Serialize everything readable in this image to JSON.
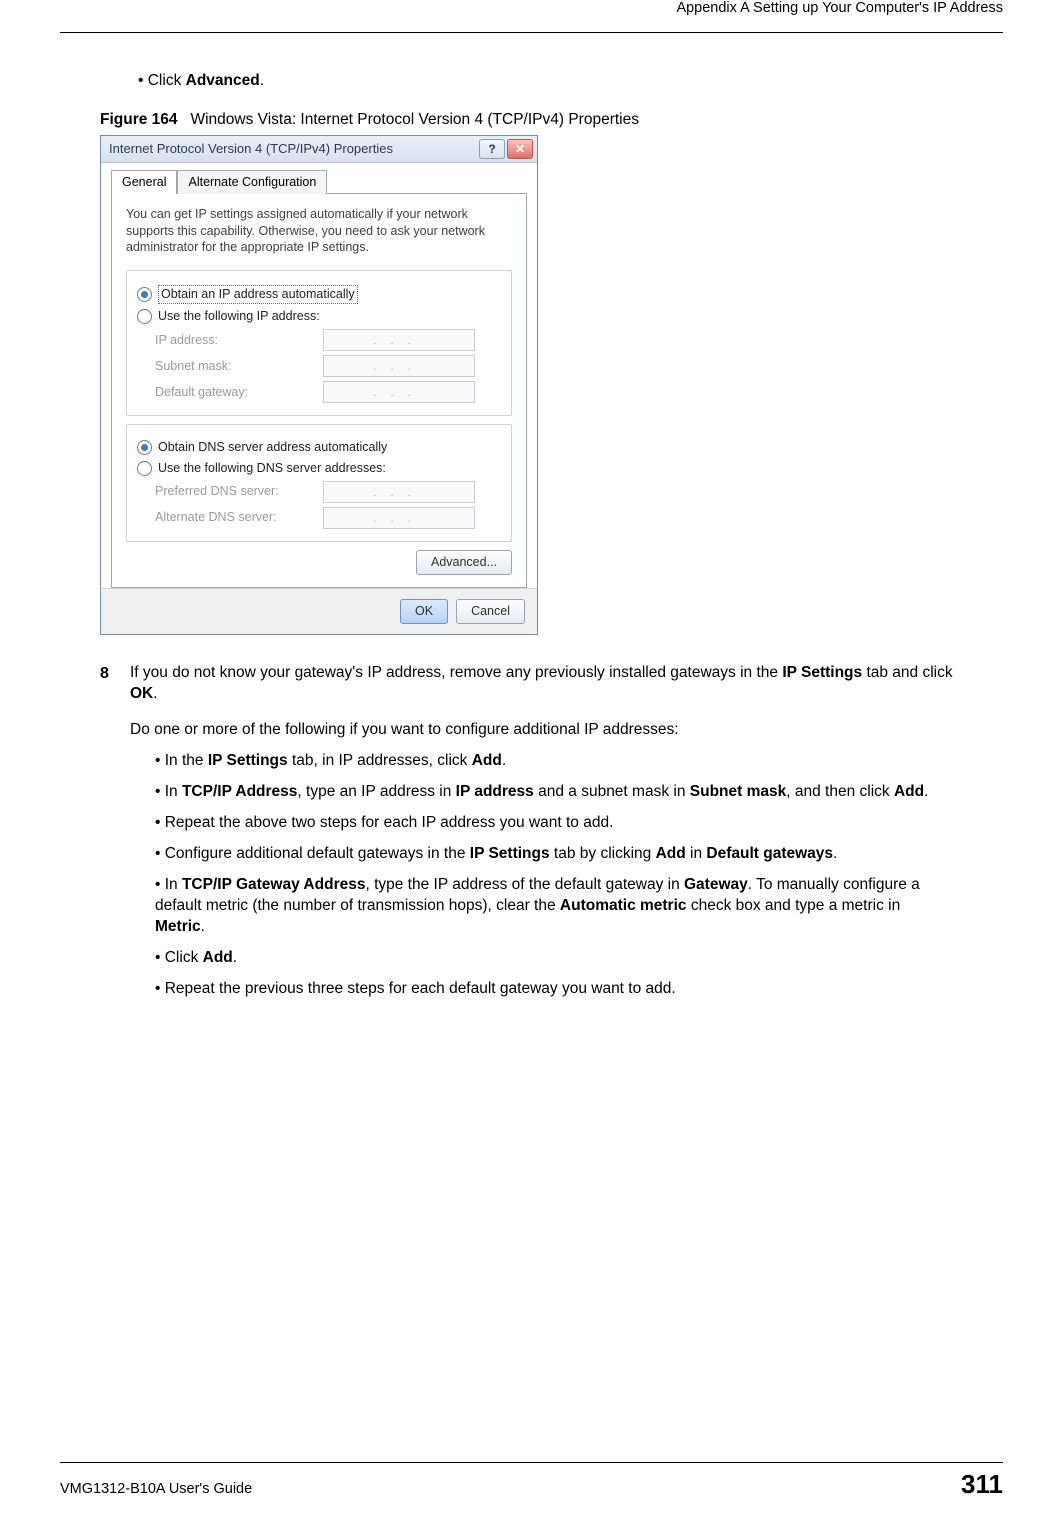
{
  "header": {
    "appendix": "Appendix A Setting up Your Computer's IP Address"
  },
  "intro_bullet": {
    "prefix": "Click ",
    "bold": "Advanced",
    "suffix": "."
  },
  "figure": {
    "label": "Figure 164",
    "caption": "Windows Vista: Internet Protocol Version 4 (TCP/IPv4) Properties"
  },
  "dialog": {
    "title": "Internet Protocol Version 4 (TCP/IPv4) Properties",
    "help_glyph": "?",
    "close_glyph": "✕",
    "tabs": {
      "general": "General",
      "alt": "Alternate Configuration"
    },
    "desc": "You can get IP settings assigned automatically if your network supports this capability. Otherwise, you need to ask your network administrator for the appropriate IP settings.",
    "ip_group": {
      "auto": "Obtain an IP address automatically",
      "manual": "Use the following IP address:",
      "ip_label": "IP address:",
      "subnet_label": "Subnet mask:",
      "gateway_label": "Default gateway:"
    },
    "dns_group": {
      "auto": "Obtain DNS server address automatically",
      "manual": "Use the following DNS server addresses:",
      "pref_label": "Preferred DNS server:",
      "alt_label": "Alternate DNS server:"
    },
    "ip_placeholder": "...",
    "advanced_btn": "Advanced...",
    "ok_btn": "OK",
    "cancel_btn": "Cancel"
  },
  "step8": {
    "num": "8",
    "t1": "If you do not know your gateway's IP address, remove any previously installed gateways in the ",
    "b1": "IP Settings",
    "t2": " tab and click ",
    "b2": "OK",
    "t3": "."
  },
  "para_do": "Do one or more of the following if you want to configure additional IP addresses:",
  "bul1": {
    "t1": "In the ",
    "b1": "IP Settings",
    "t2": " tab, in IP addresses, click ",
    "b2": "Add",
    "t3": "."
  },
  "bul2": {
    "t1": "In ",
    "b1": "TCP/IP Address",
    "t2": ", type an IP address in ",
    "b2": "IP address",
    "t3": " and a subnet mask in ",
    "b3": "Subnet mask",
    "t4": ", and then click ",
    "b4": "Add",
    "t5": "."
  },
  "bul3": {
    "t1": "Repeat the above two steps for each IP address you want to add."
  },
  "bul4": {
    "t1": "Configure additional default gateways in the ",
    "b1": "IP Settings",
    "t2": " tab by clicking ",
    "b2": "Add",
    "t3": " in ",
    "b3": "Default gateways",
    "t4": "."
  },
  "bul5": {
    "t1": "In ",
    "b1": "TCP/IP Gateway Address",
    "t2": ", type the IP address of the default gateway in ",
    "b2": "Gateway",
    "t3": ". To manually configure a default metric (the number of transmission hops), clear the ",
    "b3": "Automatic metric",
    "t4": " check box and type a metric in ",
    "b4": "Metric",
    "t5": "."
  },
  "bul6": {
    "t1": "Click ",
    "b1": "Add",
    "t2": "."
  },
  "bul7": {
    "t1": "Repeat the previous three steps for each default gateway you want to add."
  },
  "footer": {
    "guide": "VMG1312-B10A User's Guide",
    "page": "311"
  }
}
